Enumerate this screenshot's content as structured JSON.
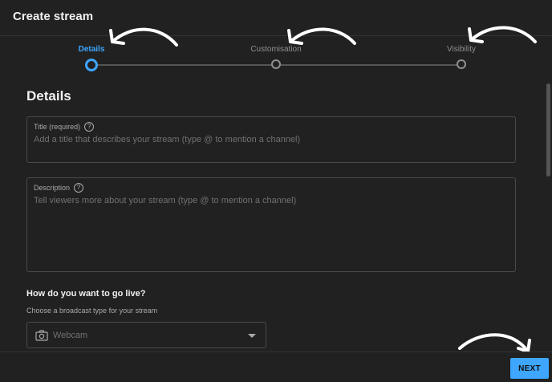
{
  "header": {
    "title": "Create stream"
  },
  "stepper": {
    "steps": [
      {
        "label": "Details",
        "active": true
      },
      {
        "label": "Customisation",
        "active": false
      },
      {
        "label": "Visibility",
        "active": false
      }
    ]
  },
  "details": {
    "section_title": "Details",
    "title_field": {
      "label": "Title (required)",
      "placeholder": "Add a title that describes your stream (type @ to mention a channel)",
      "value": ""
    },
    "description_field": {
      "label": "Description",
      "placeholder": "Tell viewers more about your stream (type @ to mention a channel)",
      "value": ""
    },
    "help_glyph": "?"
  },
  "go_live": {
    "title": "How do you want to go live?",
    "subtitle": "Choose a broadcast type for your stream",
    "broadcast_type": {
      "selected": "Webcam",
      "icon": "camera-icon"
    }
  },
  "footer": {
    "next_label": "NEXT"
  },
  "colors": {
    "accent": "#3ea6ff",
    "background": "#212121",
    "border": "#4a4a4a",
    "muted_text": "#717171"
  }
}
